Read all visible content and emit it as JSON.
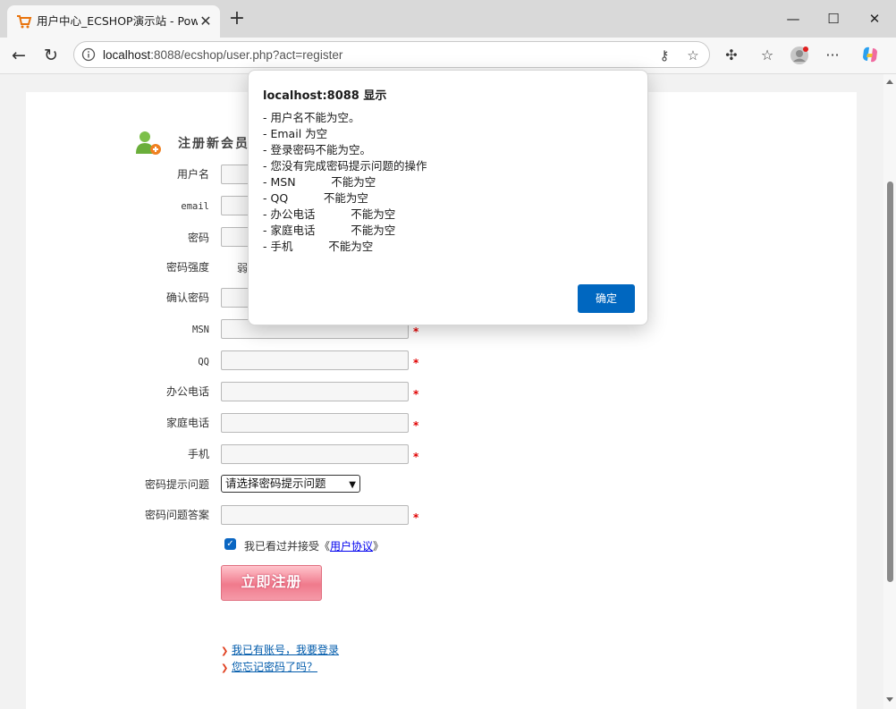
{
  "browser": {
    "tab_title": "用户中心_ECSHOP演示站 - Powered by ECShop",
    "tab_close": "✕",
    "new_tab": "+",
    "url_host": "localhost",
    "url_rest": ":8088/ecshop/user.php?act=register",
    "window_min": "—",
    "window_max": "☐",
    "window_close": "✕"
  },
  "page": {
    "heading": "注册新会员",
    "fields": {
      "username_label": "用户名",
      "email_label": "email",
      "password_label": "密码",
      "strength_label": "密码强度",
      "strength_value": "弱",
      "confirm_label": "确认密码",
      "msn_label": "MSN",
      "qq_label": "QQ",
      "office_phone_label": "办公电话",
      "home_phone_label": "家庭电话",
      "mobile_label": "手机",
      "hint_question_label": "密码提示问题",
      "hint_question_selected": "请选择密码提示问题",
      "hint_answer_label": "密码问题答案",
      "required_mark": "*"
    },
    "agreement": {
      "checked": true,
      "text": "我已看过并接受《",
      "link": "用户协议",
      "suffix": "》"
    },
    "submit_label": "立即注册",
    "links": {
      "login": "我已有账号，我要登录",
      "forgot": "您忘记密码了吗？"
    }
  },
  "dialog": {
    "title": "localhost:8088 显示",
    "lines": [
      "- 用户名不能为空。",
      "- Email 为空",
      "- 登录密码不能为空。",
      "- 您没有完成密码提示问题的操作",
      "- MSN          不能为空",
      "- QQ          不能为空",
      "- 办公电话          不能为空",
      "- 家庭电话          不能为空",
      "- 手机          不能为空"
    ],
    "ok_label": "确定"
  }
}
